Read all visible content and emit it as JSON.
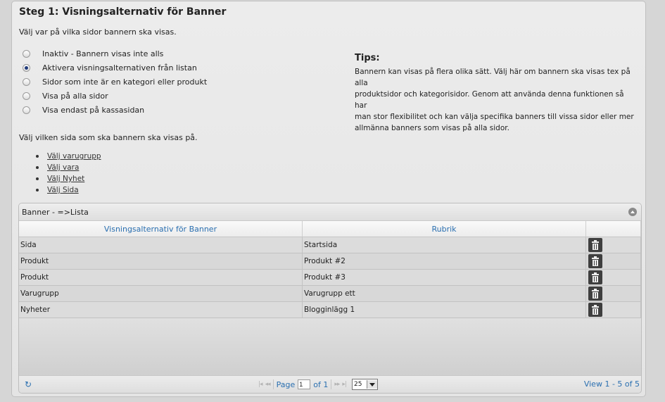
{
  "step": {
    "title": "Steg 1: Visningsalternativ för Banner",
    "intro": "Välj var på vilka sidor bannern ska visas."
  },
  "options": [
    {
      "label": "Inaktiv - Bannern visas inte alls",
      "checked": false
    },
    {
      "label": "Aktivera visningsalternativen från listan",
      "checked": true
    },
    {
      "label": "Sidor som inte är en kategori eller produkt",
      "checked": false
    },
    {
      "label": "Visa på alla sidor",
      "checked": false
    },
    {
      "label": "Visa endast på kassasidan",
      "checked": false
    }
  ],
  "tips": {
    "title": "Tips:",
    "lines": [
      "Bannern kan visas på flera olika sätt. Välj här om bannern ska visas tex på alla",
      "produktsidor och kategorisidor. Genom att använda denna funktionen så har",
      "man stor flexibilitet och kan välja specifika banners till vissa sidor eller mer",
      "allmänna banners som visas på alla sidor."
    ]
  },
  "choose": {
    "label": "Välj vilken sida som ska bannern ska visas på.",
    "links": [
      "Välj varugrupp",
      "Välj vara",
      "Välj Nyhet",
      "Välj Sida"
    ]
  },
  "grid": {
    "caption": "Banner - =>Lista",
    "columns": [
      "Visningsalternativ för Banner",
      "Rubrik",
      ""
    ],
    "rows": [
      {
        "type": "Sida",
        "title": "Startsida"
      },
      {
        "type": "Produkt",
        "title": "Produkt #2"
      },
      {
        "type": "Produkt",
        "title": "Produkt #3"
      },
      {
        "type": "Varugrupp",
        "title": "Varugrupp ett"
      },
      {
        "type": "Nyheter",
        "title": "Blogginlägg 1"
      }
    ],
    "pager": {
      "page_label": "Page",
      "page_value": "1",
      "of_label": "of 1",
      "rows_per_page": "25",
      "view_info": "View 1 - 5 of 5"
    }
  },
  "colors": {
    "accent": "#2a6fb0",
    "background": "#d6d6d6",
    "panel": "#e8e8e8"
  },
  "icons": [
    "radio-icon",
    "trash-icon",
    "refresh-icon",
    "first-page-icon",
    "prev-page-icon",
    "next-page-icon",
    "last-page-icon",
    "collapse-icon"
  ]
}
